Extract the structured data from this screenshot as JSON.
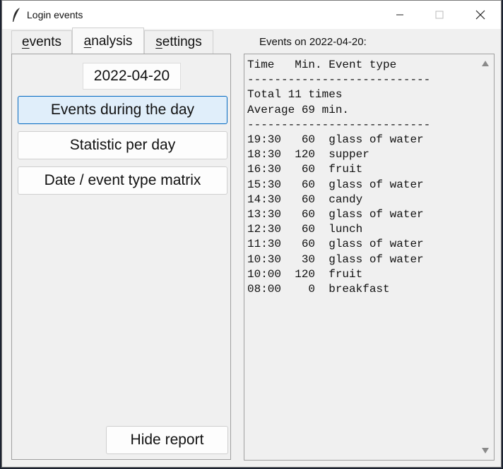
{
  "window": {
    "title": "Login events"
  },
  "tabs": [
    {
      "label_first": "e",
      "label_rest": "vents"
    },
    {
      "label_first": "a",
      "label_rest": "nalysis"
    },
    {
      "label_first": "s",
      "label_rest": "ettings"
    }
  ],
  "analysis": {
    "date": "2022-04-20",
    "buttons": [
      {
        "label": "Events during the day"
      },
      {
        "label": "Statistic per day"
      },
      {
        "label": "Date / event type matrix"
      }
    ],
    "hide_report_label": "Hide report"
  },
  "report": {
    "label": "Events on 2022-04-20:",
    "lines": [
      "Time   Min. Event type",
      "---------------------------",
      "Total 11 times",
      "Average 69 min.",
      "---------------------------",
      "19:30   60  glass of water",
      "18:30  120  supper",
      "16:30   60  fruit",
      "15:30   60  glass of water",
      "14:30   60  candy",
      "13:30   60  glass of water",
      "12:30   60  lunch",
      "11:30   60  glass of water",
      "10:30   30  glass of water",
      "10:00  120  fruit",
      "08:00    0  breakfast"
    ]
  },
  "colors": {
    "accent": "#0067c0",
    "active_button_bg": "#e0eefa"
  }
}
